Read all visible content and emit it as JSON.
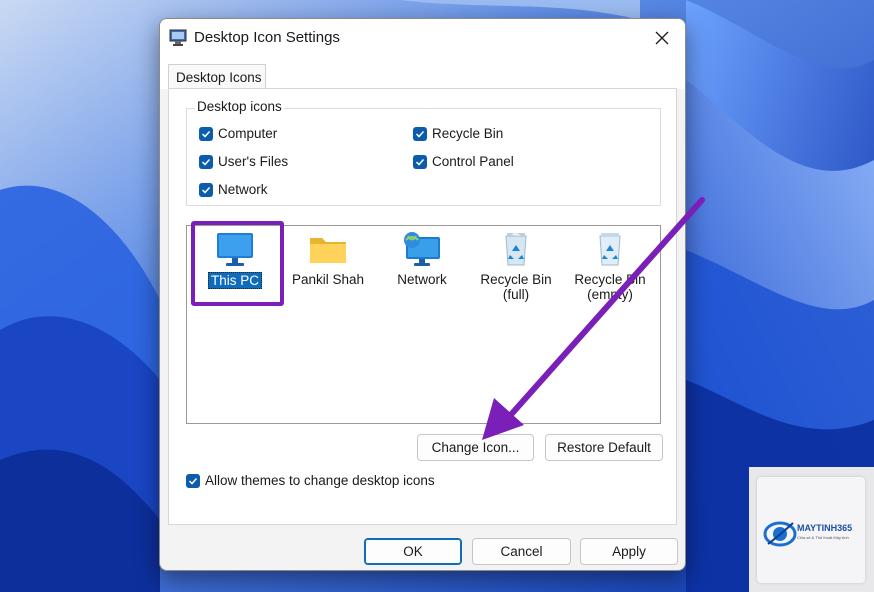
{
  "window": {
    "title": "Desktop Icon Settings"
  },
  "tabs": [
    {
      "label": "Desktop Icons"
    }
  ],
  "desktop_icons_group": {
    "legend": "Desktop icons",
    "checkboxes": [
      {
        "label": "Computer",
        "checked": true
      },
      {
        "label": "Recycle Bin",
        "checked": true
      },
      {
        "label": "User's Files",
        "checked": true
      },
      {
        "label": "Control Panel",
        "checked": true
      },
      {
        "label": "Network",
        "checked": true
      }
    ]
  },
  "icon_list": {
    "items": [
      {
        "label": "This PC",
        "icon": "monitor-icon",
        "selected": true
      },
      {
        "label": "Pankil Shah",
        "icon": "folder-icon",
        "selected": false
      },
      {
        "label": "Network",
        "icon": "network-icon",
        "selected": false
      },
      {
        "label_line1": "Recycle Bin",
        "label_line2": "(full)",
        "icon": "recycle-bin-full-icon",
        "selected": false
      },
      {
        "label_line1": "Recycle Bin",
        "label_line2": "(empty)",
        "icon": "recycle-bin-empty-icon",
        "selected": false
      }
    ]
  },
  "buttons": {
    "change_icon": "Change Icon...",
    "restore_default": "Restore Default",
    "ok": "OK",
    "cancel": "Cancel",
    "apply": "Apply"
  },
  "allow_themes": {
    "label": "Allow themes to change desktop icons",
    "checked": true
  },
  "watermark": {
    "brand": "MAYTINH365",
    "tagline": "Chia sẻ & Thủ thuật Máy tính"
  },
  "colors": {
    "accent": "#0f6cbd",
    "highlight": "#7a1fb8",
    "checkbox": "#0b5cad"
  }
}
